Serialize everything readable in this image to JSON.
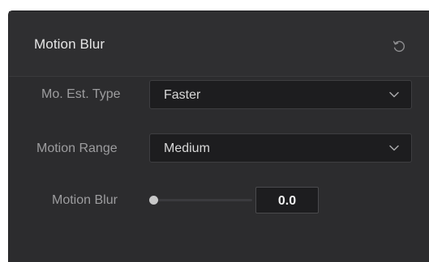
{
  "panel": {
    "title": "Motion Blur",
    "reset_icon": "reset-icon"
  },
  "rows": {
    "mo_est_type": {
      "label": "Mo. Est. Type",
      "value": "Faster",
      "icon": "chevron-down-icon"
    },
    "motion_range": {
      "label": "Motion Range",
      "value": "Medium",
      "icon": "chevron-down-icon"
    },
    "motion_blur": {
      "label": "Motion Blur",
      "value": "0.0",
      "slider_level": 0
    }
  },
  "colors": {
    "panel_bg": "#2c2c2e",
    "field_bg": "#1d1d1f",
    "label": "#9d9d9f",
    "text": "#e6e6e6"
  }
}
